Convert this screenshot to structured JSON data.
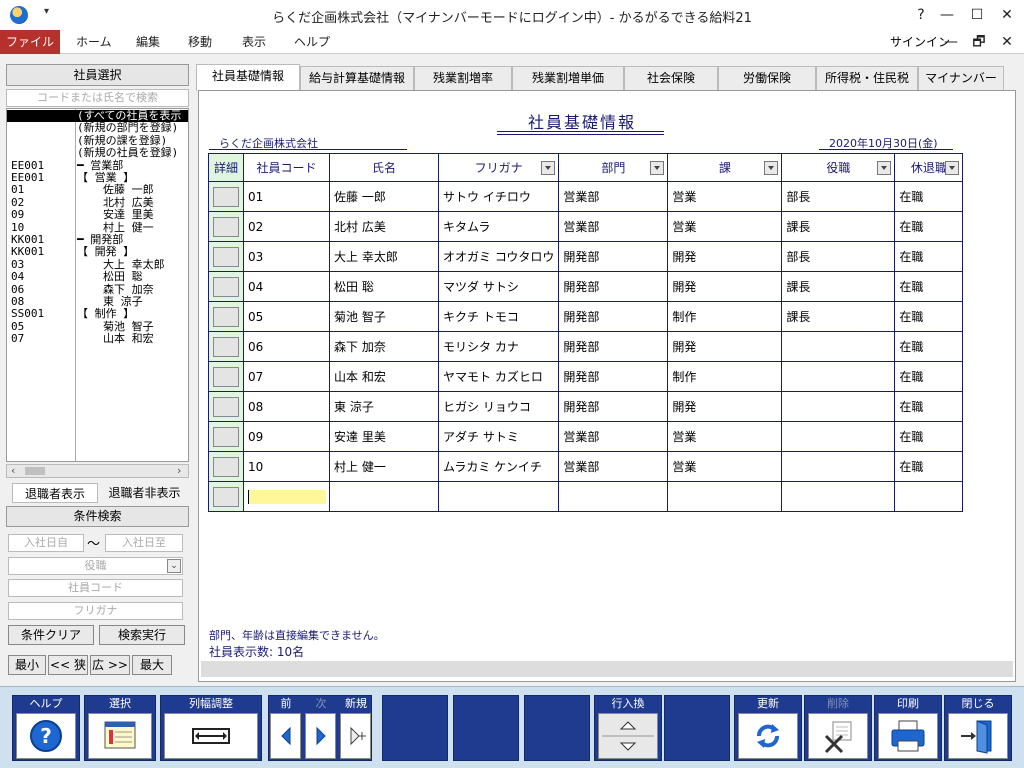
{
  "window": {
    "title": "らくだ企画株式会社（マイナンバーモードにログイン中）- かるがるできる給料21",
    "help": "?",
    "minimize": "—",
    "maximize": "☐",
    "close": "✕",
    "ribbon_min": "—",
    "restore": "🗗",
    "ribbon_close": "✕"
  },
  "menu": {
    "file": "ファイル",
    "home": "ホーム",
    "edit": "編集",
    "move": "移動",
    "view": "表示",
    "help": "ヘルプ",
    "signin": "サインイン"
  },
  "left": {
    "header": "社員選択",
    "search_placeholder": "コードまたは氏名で検索",
    "tree": [
      {
        "code": "",
        "name": "(すべての社員を表示",
        "indent": 1,
        "selected": true
      },
      {
        "code": "",
        "name": "(新規の部門を登録)",
        "indent": 1,
        "selected": false
      },
      {
        "code": "",
        "name": "(新規の課を登録)",
        "indent": 1,
        "selected": false
      },
      {
        "code": "",
        "name": "(新規の社員を登録)",
        "indent": 1,
        "selected": false
      },
      {
        "code": "EE001",
        "name": "━ 営業部",
        "indent": 1,
        "selected": false
      },
      {
        "code": "EE001",
        "name": "【 営業 】",
        "indent": 0,
        "selected": false
      },
      {
        "code": "01",
        "name": "佐藤 一郎",
        "indent": 2,
        "selected": false
      },
      {
        "code": "02",
        "name": "北村 広美",
        "indent": 2,
        "selected": false
      },
      {
        "code": "09",
        "name": "安達 里美",
        "indent": 2,
        "selected": false
      },
      {
        "code": "10",
        "name": "村上 健一",
        "indent": 2,
        "selected": false
      },
      {
        "code": "KK001",
        "name": "━ 開発部",
        "indent": 1,
        "selected": false
      },
      {
        "code": "KK001",
        "name": "【 開発 】",
        "indent": 0,
        "selected": false
      },
      {
        "code": "03",
        "name": "大上 幸太郎",
        "indent": 2,
        "selected": false
      },
      {
        "code": "04",
        "name": "松田 聡",
        "indent": 2,
        "selected": false
      },
      {
        "code": "06",
        "name": "森下 加奈",
        "indent": 2,
        "selected": false
      },
      {
        "code": "08",
        "name": "東 涼子",
        "indent": 2,
        "selected": false
      },
      {
        "code": "SS001",
        "name": "【 制作 】",
        "indent": 0,
        "selected": false
      },
      {
        "code": "05",
        "name": "菊池 智子",
        "indent": 2,
        "selected": false
      },
      {
        "code": "07",
        "name": "山本 和宏",
        "indent": 2,
        "selected": false
      }
    ],
    "show_retired": "退職者表示",
    "hide_retired": "退職者非表示",
    "cond_header": "条件検索",
    "date_from": "入社日自",
    "date_sep": "〜",
    "date_to": "入社日至",
    "role_placeholder": "役職",
    "code_placeholder": "社員コード",
    "kana_placeholder": "フリガナ",
    "clear": "条件クリア",
    "run": "検索実行",
    "min": "最小",
    "narrow": "<< 狭",
    "wide": "広 >>",
    "max": "最大"
  },
  "tabs": [
    "社員基礎情報",
    "給与計算基礎情報",
    "残業割増率",
    "残業割増単価",
    "社会保険",
    "労働保険",
    "所得税・住民税",
    "マイナンバー"
  ],
  "main": {
    "title": "社員基礎情報",
    "company": "らくだ企画株式会社",
    "date": "2020年10月30日(金)",
    "columns": [
      "詳細",
      "社員コード",
      "氏名",
      "フリガナ",
      "部門",
      "課",
      "役職",
      "休退職"
    ],
    "rows": [
      [
        "01",
        "佐藤 一郎",
        "サトウ イチロウ",
        "営業部",
        "営業",
        "部長",
        "在職"
      ],
      [
        "02",
        "北村 広美",
        "キタムラ",
        "営業部",
        "営業",
        "課長",
        "在職"
      ],
      [
        "03",
        "大上 幸太郎",
        "オオガミ コウタロウ",
        "開発部",
        "開発",
        "部長",
        "在職"
      ],
      [
        "04",
        "松田 聡",
        "マツダ サトシ",
        "開発部",
        "開発",
        "課長",
        "在職"
      ],
      [
        "05",
        "菊池 智子",
        "キクチ トモコ",
        "開発部",
        "制作",
        "課長",
        "在職"
      ],
      [
        "06",
        "森下 加奈",
        "モリシタ カナ",
        "開発部",
        "開発",
        "",
        "在職"
      ],
      [
        "07",
        "山本 和宏",
        "ヤマモト カズヒロ",
        "開発部",
        "制作",
        "",
        "在職"
      ],
      [
        "08",
        "東 涼子",
        "ヒガシ リョウコ",
        "開発部",
        "開発",
        "",
        "在職"
      ],
      [
        "09",
        "安達 里美",
        "アダチ サトミ",
        "営業部",
        "営業",
        "",
        "在職"
      ],
      [
        "10",
        "村上 健一",
        "ムラカミ ケンイチ",
        "営業部",
        "営業",
        "",
        "在職"
      ]
    ],
    "note": "部門、年齢は直接編集できません。",
    "count": "社員表示数: 10名"
  },
  "toolbar": {
    "help": "ヘルプ",
    "select": "選択",
    "colwidth": "列幅調整",
    "prev": "前",
    "next": "次",
    "new": "新規",
    "row_swap": "行入換",
    "update": "更新",
    "delete": "削除",
    "print": "印刷",
    "close": "閉じる"
  },
  "colors": {
    "accent": "#1f3b8f",
    "file_menu": "#b7312c",
    "grid_text": "#1a1a70",
    "detail_bg": "#dff5df",
    "edit_cell": "#fff79a"
  }
}
